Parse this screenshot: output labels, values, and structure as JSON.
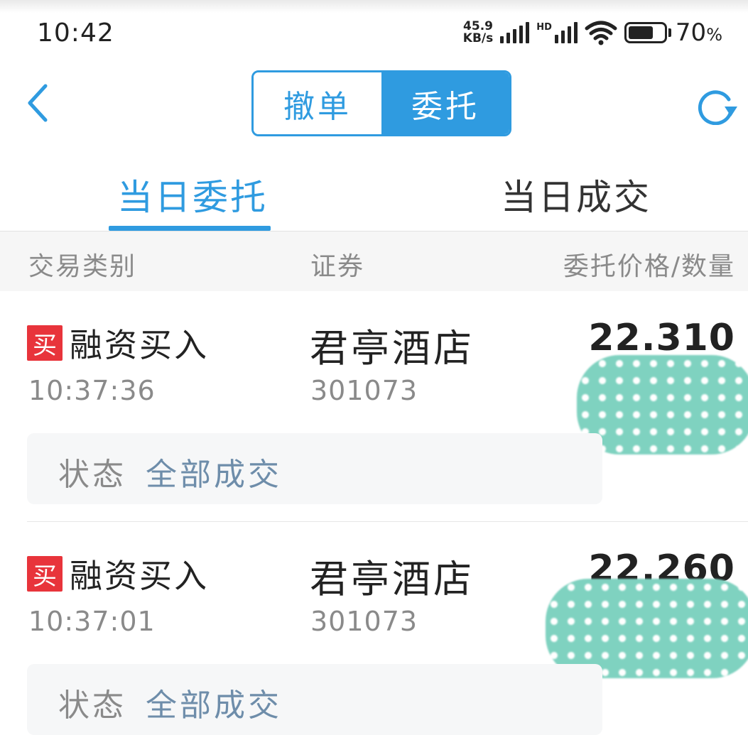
{
  "status_bar": {
    "time": "10:42",
    "net_speed_value": "45.9",
    "net_speed_unit": "KB/s",
    "hd_label": "HD",
    "battery_percent": "70",
    "battery_percent_sign": "%",
    "battery_level": 0.7
  },
  "nav": {
    "segments": [
      {
        "label": "撤单",
        "active": false
      },
      {
        "label": "委托",
        "active": true
      }
    ]
  },
  "tabs": [
    {
      "label": "当日委托",
      "active": true
    },
    {
      "label": "当日成交",
      "active": false
    }
  ],
  "columns": {
    "type": "交易类别",
    "security": "证券",
    "price_qty": "委托价格/数量"
  },
  "orders": [
    {
      "badge": "买",
      "trade_type": "融资买入",
      "time": "10:37:36",
      "security_name": "君亭酒店",
      "security_code": "301073",
      "price": "22.310",
      "status_label": "状态",
      "status_value": "全部成交"
    },
    {
      "badge": "买",
      "trade_type": "融资买入",
      "time": "10:37:01",
      "security_name": "君亭酒店",
      "security_code": "301073",
      "price": "22.260",
      "status_label": "状态",
      "status_value": "全部成交"
    }
  ],
  "colors": {
    "accent": "#2f9be0",
    "buy_badge": "#e8343b",
    "status_value": "#6e8daa",
    "redaction": "#7fd2c0"
  }
}
